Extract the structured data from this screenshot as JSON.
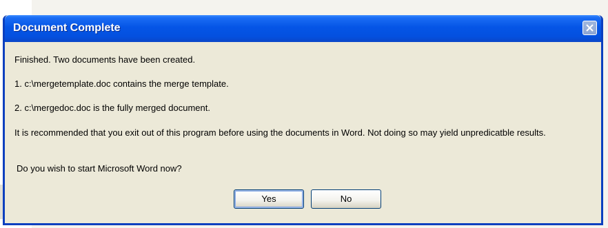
{
  "dialog": {
    "title": "Document Complete",
    "messages": [
      "Finished.  Two documents have been created.",
      "1. c:\\mergetemplate.doc contains the merge template.",
      "2. c:\\mergedoc.doc is the fully merged document.",
      "It is recommended that you exit out of this program before using the documents in Word.  Not doing so may yield unpredicatble results.",
      "Do you wish to start Microsoft Word now?"
    ],
    "buttons": {
      "yes": "Yes",
      "no": "No"
    },
    "close_icon": "close-icon"
  },
  "colors": {
    "titlebar": "#0555e6",
    "frame": "#0a3fbf",
    "dialog_bg": "#ece9d8",
    "title_text": "#ffffff"
  }
}
